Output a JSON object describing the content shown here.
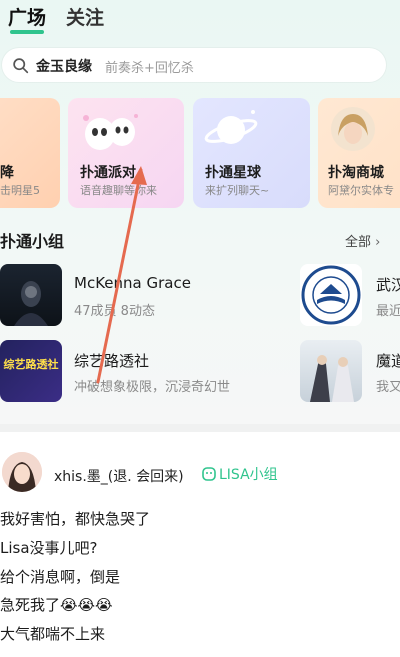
{
  "tabs": {
    "plaza": "广场",
    "follow": "关注"
  },
  "search": {
    "main": "金玉良缘",
    "sub": "前奏杀+回忆杀"
  },
  "cards": [
    {
      "title": "降",
      "sub": "击明星5"
    },
    {
      "title": "扑通派对",
      "sub": "语音趣聊等你来"
    },
    {
      "title": "扑通星球",
      "sub": "来扩列聊天~"
    },
    {
      "title": "扑淘商城",
      "sub": "阿黛尔实体专"
    }
  ],
  "section": {
    "title": "扑通小组",
    "all": "全部"
  },
  "groups": [
    {
      "name": "McKenna Grace",
      "info": "47成员 8动态"
    },
    {
      "name": "武汉",
      "info": "最近"
    },
    {
      "name": "综艺路透社",
      "info": "冲破想象极限，沉浸奇幻世"
    },
    {
      "name": "魔道",
      "info": "我又"
    }
  ],
  "group_thumb_text": {
    "variety": "综艺路透社"
  },
  "post": {
    "username": "xhis.墨_(退. 会回来)",
    "tag": "LISA小组",
    "lines": [
      "我好害怕，都快急哭了",
      "Lisa没事儿吧?",
      "给个消息啊，倒是",
      "急死我了😭😭😭",
      "大气都喘不上来"
    ]
  },
  "colors": {
    "accent": "#2fc48d",
    "arrow": "#e56a4f"
  }
}
